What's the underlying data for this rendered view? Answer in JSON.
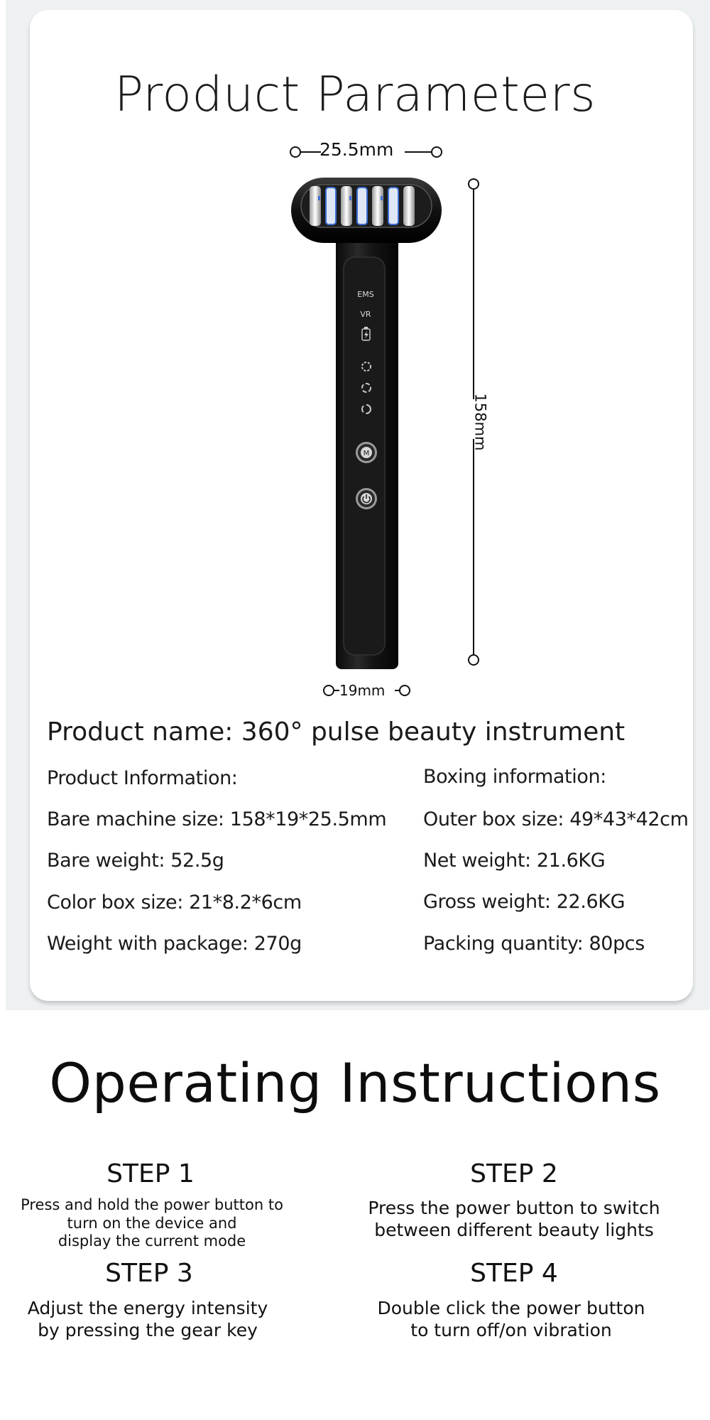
{
  "parameters": {
    "title": "Product Parameters",
    "dimensions": {
      "width": "25.5mm",
      "length": "158mm",
      "base": "19mm"
    },
    "device_labels": {
      "ems": "EMS",
      "vr": "VR"
    },
    "product_name": "Product name: 360° pulse beauty instrument",
    "left_column": {
      "heading": "Product Information:",
      "rows": [
        "Bare machine size: 158*19*25.5mm",
        "Bare weight: 52.5g",
        "Color box size: 21*8.2*6cm",
        "Weight with package: 270g"
      ]
    },
    "right_column": {
      "heading": "Boxing information:",
      "rows": [
        "Outer box size: 49*43*42cm",
        "Net weight: 21.6KG",
        "Gross weight: 22.6KG",
        "Packing quantity: 80pcs"
      ]
    }
  },
  "instructions": {
    "title": "Operating Instructions",
    "steps": [
      {
        "label": "STEP 1",
        "lines": [
          "Press and hold the power button to",
          "turn on the device and",
          "display the current mode"
        ]
      },
      {
        "label": "STEP 2",
        "lines": [
          "Press the power button to switch",
          "between different beauty lights"
        ]
      },
      {
        "label": "STEP 3",
        "lines": [
          "Adjust the energy intensity",
          "by pressing the gear key"
        ]
      },
      {
        "label": "STEP 4",
        "lines": [
          "Double click the power button",
          "to turn off/on vibration"
        ]
      }
    ]
  },
  "colors": {
    "device_body": "#151515",
    "led_blue": "#3d6fd6",
    "background_top": "#eef1f2"
  },
  "icons": [
    "battery-icon",
    "mode-ring-icon",
    "gear-button-icon",
    "power-button-icon"
  ]
}
